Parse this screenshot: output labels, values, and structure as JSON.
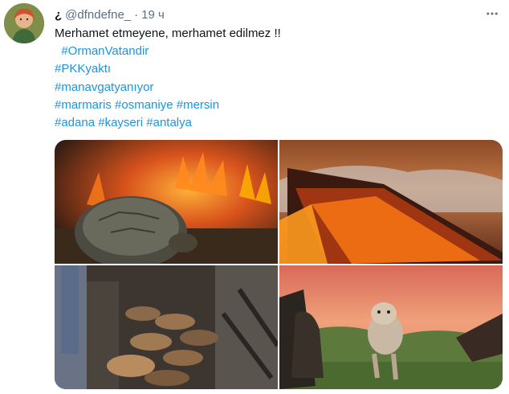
{
  "author": {
    "display_name": "¿",
    "handle": "@dfndefne_",
    "separator": "·",
    "time": "19 ч",
    "avatar_icon": "profile-avatar"
  },
  "tweet": {
    "text_lines": [
      "Merhamet etmeyene,  merhamet edilmez  !!"
    ],
    "hashtag_lines": [
      [
        "#OrmanVatandir"
      ],
      [
        "#PKKyaktı"
      ],
      [
        "#manavgatyanıyor"
      ],
      [
        "#marmaris",
        "#osmaniye",
        "#mersin"
      ],
      [
        "#adana",
        "#kayseri",
        "#antalya"
      ]
    ]
  },
  "media": {
    "photos": [
      {
        "name": "tortoise-in-fire-photo"
      },
      {
        "name": "burning-forest-hillside-photo"
      },
      {
        "name": "burned-animals-barn-photo"
      },
      {
        "name": "injured-dog-photo"
      }
    ]
  },
  "icons": {
    "more": "more-options-icon"
  },
  "colors": {
    "hashtag": "#1b95e0",
    "secondary_text": "#5b7083",
    "primary_text": "#0f1419"
  }
}
